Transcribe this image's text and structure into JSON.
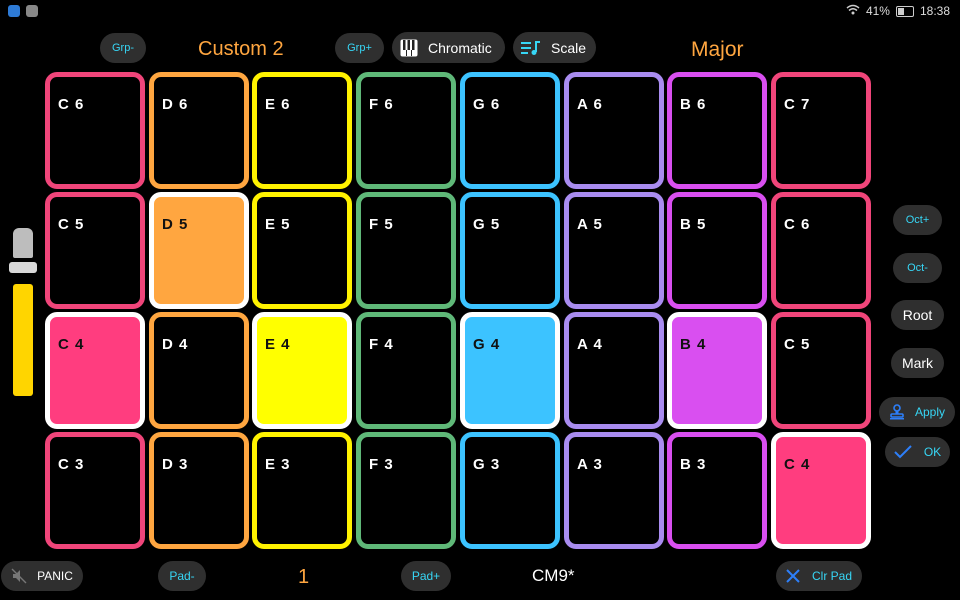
{
  "status_bar": {
    "battery": "41%",
    "time": "18:38"
  },
  "top_bar": {
    "grp_minus": "Grp-",
    "group_name": "Custom 2",
    "grp_plus": "Grp+",
    "chromatic_label": "Chromatic",
    "scale_label": "Scale",
    "scale_name": "Major"
  },
  "side_controls": {
    "oct_plus": "Oct+",
    "oct_minus": "Oct-",
    "root": "Root",
    "mark": "Mark",
    "apply": "Apply",
    "ok": "OK"
  },
  "bottom_bar": {
    "panic": "PANIC",
    "pad_minus": "Pad-",
    "pad_number": "1",
    "pad_plus": "Pad+",
    "chord": "CM9*",
    "clear_pad": "Clr Pad"
  },
  "colors": {
    "C": "#f0457a",
    "D": "#ffa640",
    "E": "#fff200",
    "F": "#5fb878",
    "G": "#3cc3ff",
    "A": "#a98cf0",
    "B": "#d94ff0",
    "filled_C": "#ff3d7f",
    "filled_D": "#ffa640",
    "filled_E": "#ffff00",
    "filled_G": "#3cc3ff",
    "filled_B": "#d94ff0"
  },
  "pads": [
    [
      {
        "label": "C 6",
        "note": "C",
        "filled": false
      },
      {
        "label": "D 6",
        "note": "D",
        "filled": false
      },
      {
        "label": "E 6",
        "note": "E",
        "filled": false
      },
      {
        "label": "F 6",
        "note": "F",
        "filled": false
      },
      {
        "label": "G 6",
        "note": "G",
        "filled": false
      },
      {
        "label": "A 6",
        "note": "A",
        "filled": false
      },
      {
        "label": "B 6",
        "note": "B",
        "filled": false
      },
      {
        "label": "C 7",
        "note": "C",
        "filled": false
      }
    ],
    [
      {
        "label": "C 5",
        "note": "C",
        "filled": false
      },
      {
        "label": "D 5",
        "note": "D",
        "filled": true
      },
      {
        "label": "E 5",
        "note": "E",
        "filled": false
      },
      {
        "label": "F 5",
        "note": "F",
        "filled": false
      },
      {
        "label": "G 5",
        "note": "G",
        "filled": false
      },
      {
        "label": "A 5",
        "note": "A",
        "filled": false
      },
      {
        "label": "B 5",
        "note": "B",
        "filled": false
      },
      {
        "label": "C 6",
        "note": "C",
        "filled": false
      }
    ],
    [
      {
        "label": "C 4",
        "note": "C",
        "filled": true
      },
      {
        "label": "D 4",
        "note": "D",
        "filled": false
      },
      {
        "label": "E 4",
        "note": "E",
        "filled": true
      },
      {
        "label": "F 4",
        "note": "F",
        "filled": false
      },
      {
        "label": "G 4",
        "note": "G",
        "filled": true
      },
      {
        "label": "A 4",
        "note": "A",
        "filled": false
      },
      {
        "label": "B 4",
        "note": "B",
        "filled": true
      },
      {
        "label": "C 5",
        "note": "C",
        "filled": false
      }
    ],
    [
      {
        "label": "C 3",
        "note": "C",
        "filled": false
      },
      {
        "label": "D 3",
        "note": "D",
        "filled": false
      },
      {
        "label": "E 3",
        "note": "E",
        "filled": false
      },
      {
        "label": "F 3",
        "note": "F",
        "filled": false
      },
      {
        "label": "G 3",
        "note": "G",
        "filled": false
      },
      {
        "label": "A 3",
        "note": "A",
        "filled": false
      },
      {
        "label": "B 3",
        "note": "B",
        "filled": false
      },
      {
        "label": "C 4",
        "note": "C",
        "filled": true
      }
    ]
  ]
}
